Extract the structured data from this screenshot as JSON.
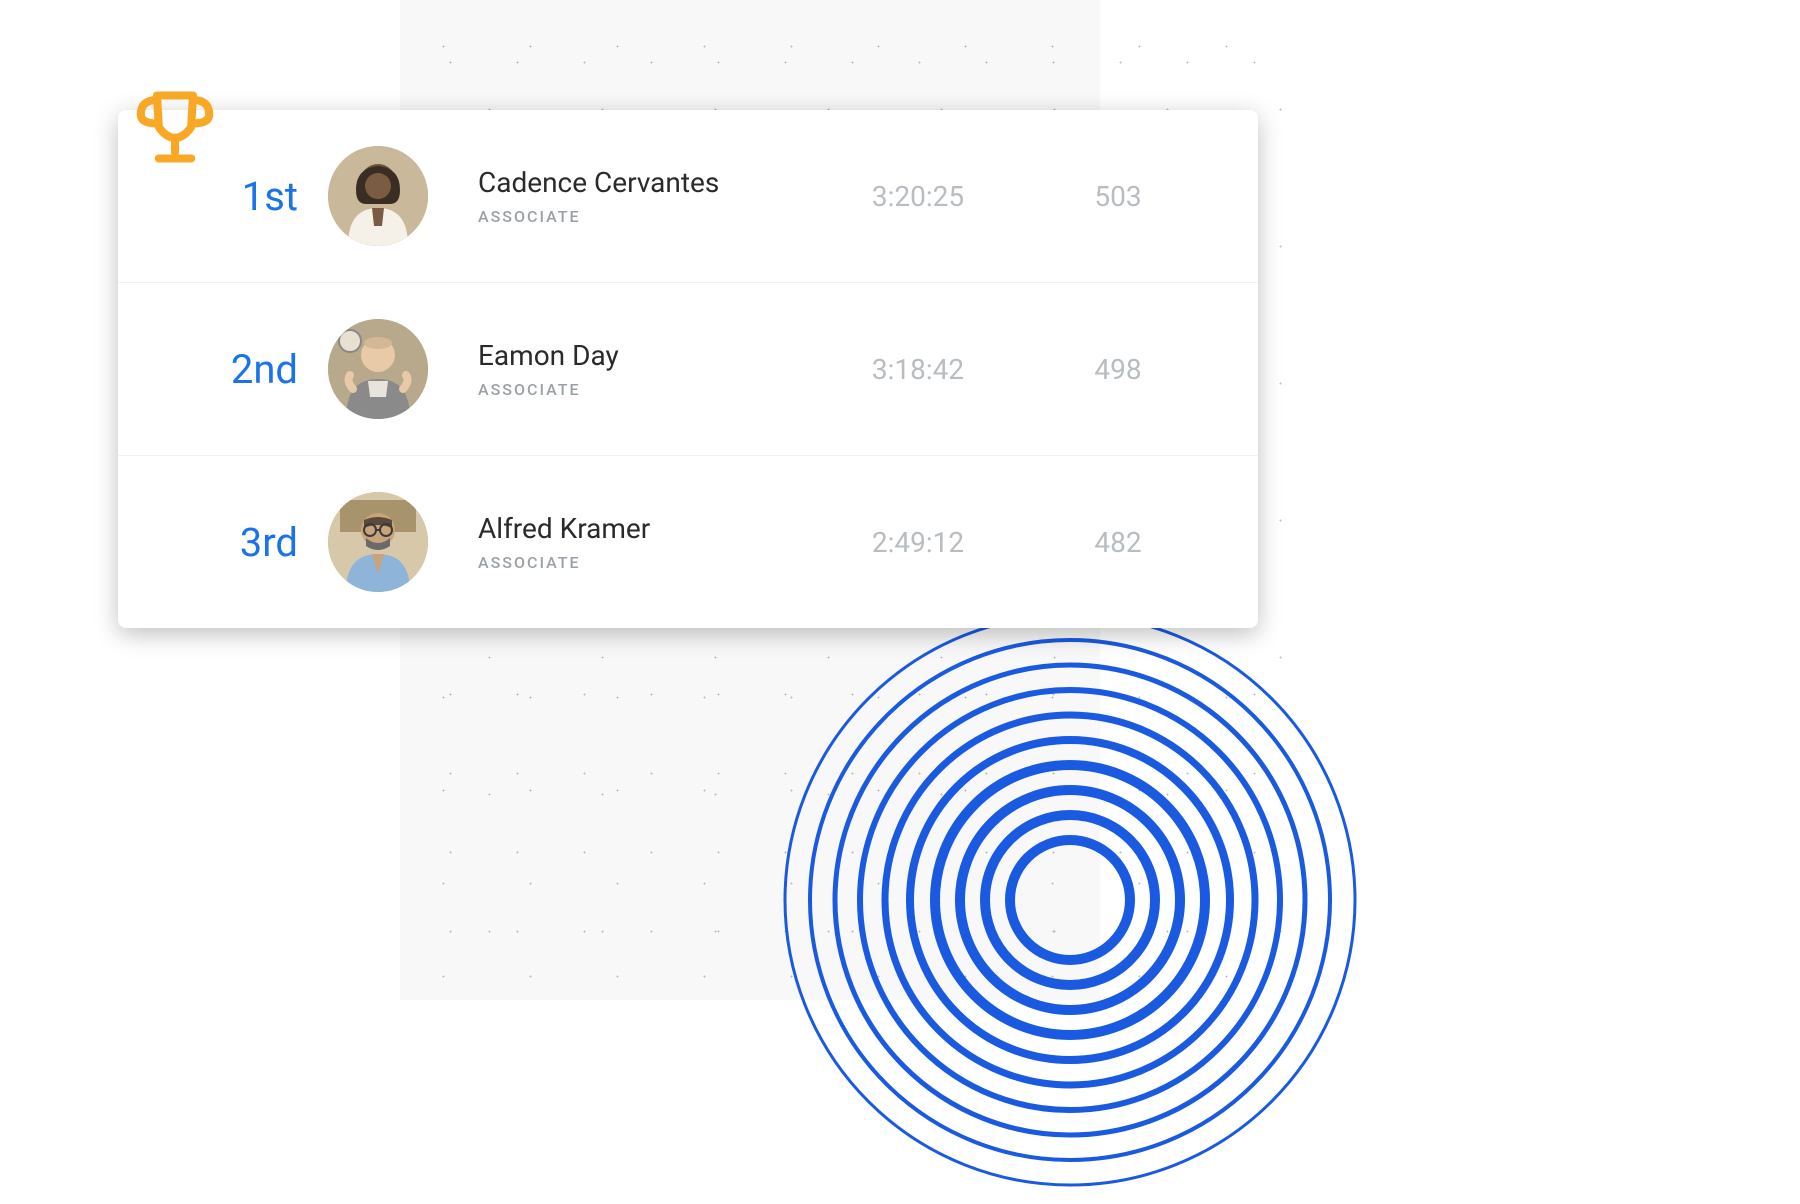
{
  "leaderboard": {
    "rows": [
      {
        "rank": "1st",
        "name": "Cadence Cervantes",
        "role": "ASSOCIATE",
        "time": "3:20:25",
        "score": "503"
      },
      {
        "rank": "2nd",
        "name": "Eamon Day",
        "role": "ASSOCIATE",
        "time": "3:18:42",
        "score": "498"
      },
      {
        "rank": "3rd",
        "name": "Alfred Kramer",
        "role": "ASSOCIATE",
        "time": "2:49:12",
        "score": "482"
      }
    ]
  },
  "colors": {
    "rank_blue": "#1a73e8",
    "muted_gray": "#b8bdc2",
    "trophy_yellow": "#f9a825"
  }
}
